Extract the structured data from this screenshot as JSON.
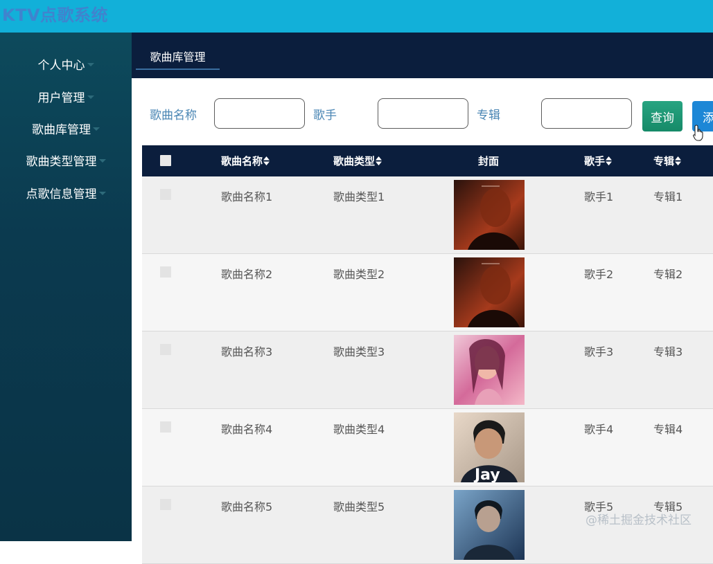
{
  "app": {
    "title": "KTV点歌系统"
  },
  "sidebar": {
    "items": [
      {
        "label": "个人中心"
      },
      {
        "label": "用户管理"
      },
      {
        "label": "歌曲库管理"
      },
      {
        "label": "歌曲类型管理"
      },
      {
        "label": "点歌信息管理"
      }
    ]
  },
  "header": {
    "active_tab": "歌曲库管理"
  },
  "search": {
    "song_name_label": "歌曲名称",
    "singer_label": "歌手",
    "album_label": "专辑",
    "song_name_value": "",
    "singer_value": "",
    "album_value": "",
    "query_button": "查询",
    "add_button": "添加"
  },
  "table": {
    "columns": [
      "歌曲名称",
      "歌曲类型",
      "封面",
      "歌手",
      "专辑"
    ],
    "rows": [
      {
        "name": "歌曲名称1",
        "type": "歌曲类型1",
        "singer": "歌手1",
        "album": "专辑1",
        "cover": "cover-red-portrait"
      },
      {
        "name": "歌曲名称2",
        "type": "歌曲类型2",
        "singer": "歌手2",
        "album": "专辑2",
        "cover": "cover-red-portrait"
      },
      {
        "name": "歌曲名称3",
        "type": "歌曲类型3",
        "singer": "歌手3",
        "album": "专辑3",
        "cover": "cover-pink-portrait"
      },
      {
        "name": "歌曲名称4",
        "type": "歌曲类型4",
        "singer": "歌手4",
        "album": "专辑4",
        "cover": "cover-jay"
      },
      {
        "name": "歌曲名称5",
        "type": "歌曲类型5",
        "singer": "歌手5",
        "album": "专辑5",
        "cover": "cover-blue-portrait"
      }
    ],
    "cover_text": {
      "cover_jay_text": "Jay"
    }
  },
  "watermark": "@稀土掘金技术社区",
  "colors": {
    "topbar": "#12b0d9",
    "sidebar": "#0b3a4f",
    "header": "#0b1e3d",
    "query_button": "#1c9a76",
    "add_button": "#1d87d6"
  }
}
